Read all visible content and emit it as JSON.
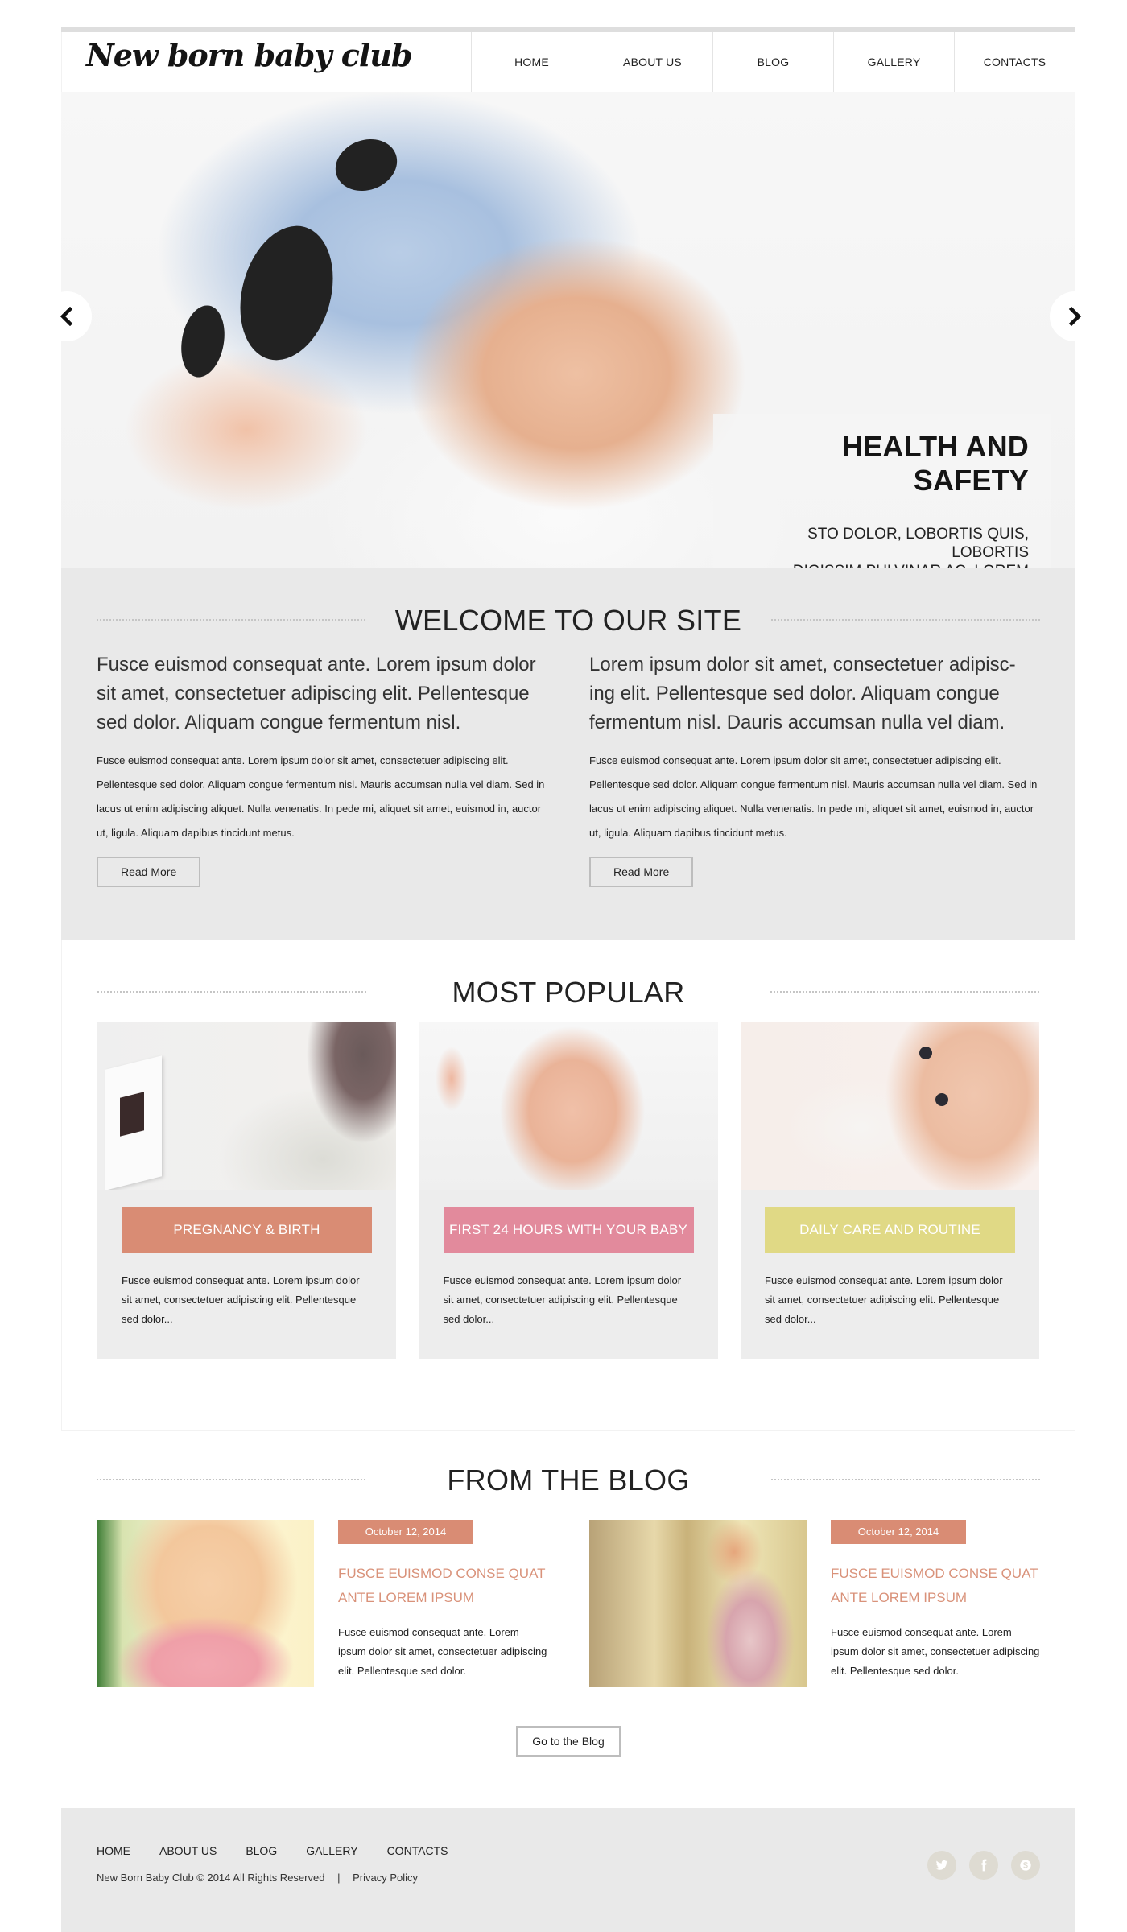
{
  "header": {
    "logo": "New born baby club",
    "nav": [
      "HOME",
      "ABOUT US",
      "BLOG",
      "GALLERY",
      "CONTACTS"
    ]
  },
  "slider": {
    "title": "HEALTH AND SAFETY",
    "subtitle_line1": "STO DOLOR, LOBORTIS QUIS, LOBORTIS",
    "subtitle_line2": "DIGISSIM PULVINAR AC, LOREM",
    "prev_icon": "chevron-left-icon",
    "next_icon": "chevron-right-icon"
  },
  "welcome": {
    "title": "WELCOME TO OUR SITE",
    "columns": [
      {
        "lead": "Fusce euismod consequat ante. Lorem ipsum dolor sit amet, consectetuer adipiscing elit. Pellentesque sed dolor. Aliquam congue fermentum nisl.",
        "body": "Fusce euismod consequat ante. Lorem ipsum dolor sit amet, consectetuer adipiscing elit. Pellentesque sed dolor. Aliquam congue fermentum nisl. Mauris accumsan nulla vel diam. Sed in lacus ut enim adipiscing aliquet. Nulla venenatis. In pede mi, aliquet sit amet, euismod in, auctor ut, ligula. Aliquam dapibus tincidunt metus.",
        "button": "Read More"
      },
      {
        "lead": "Lorem ipsum dolor sit amet, consectetuer adipisc-ing elit. Pellentesque sed dolor. Aliquam congue fermentum nisl. Dauris accumsan nulla vel diam.",
        "body": "Fusce euismod consequat ante. Lorem ipsum dolor sit amet, consectetuer adipiscing elit. Pellentesque sed dolor. Aliquam congue fermentum nisl. Mauris accumsan nulla vel diam. Sed in lacus ut enim adipiscing aliquet. Nulla venenatis. In pede mi, aliquet sit amet, euismod in, auctor ut, ligula. Aliquam dapibus tincidunt metus.",
        "button": "Read More"
      }
    ]
  },
  "popular": {
    "title": "MOST POPULAR",
    "cards": [
      {
        "label": "PREGNANCY & BIRTH",
        "color": "#d98c74",
        "text": "Fusce euismod consequat ante. Lorem ipsum dolor sit amet, consectetuer adipiscing elit. Pellentesque sed dolor..."
      },
      {
        "label": "FIRST 24 HOURS WITH YOUR BABY",
        "color": "#e28a9c",
        "text": "Fusce euismod consequat ante. Lorem ipsum dolor sit amet, consectetuer adipiscing elit. Pellentesque sed dolor..."
      },
      {
        "label": "DAILY CARE AND ROUTINE",
        "color": "#e0d985",
        "text": "Fusce euismod consequat ante. Lorem ipsum dolor sit amet, consectetuer adipiscing elit. Pellentesque sed dolor..."
      }
    ]
  },
  "blog": {
    "title": "FROM THE BLOG",
    "posts": [
      {
        "date": "October 12, 2014",
        "title": "FUSCE EUISMOD CONSE QUAT ANTE LOREM IPSUM",
        "text": "Fusce euismod consequat ante. Lorem ipsum dolor sit amet, consectetuer adipiscing elit. Pellentesque sed dolor."
      },
      {
        "date": "October 12, 2014",
        "title": "FUSCE EUISMOD CONSE QUAT ANTE LOREM IPSUM",
        "text": "Fusce euismod consequat ante. Lorem ipsum dolor sit amet, consectetuer adipiscing elit. Pellentesque sed dolor."
      }
    ],
    "button": "Go to the Blog"
  },
  "footer": {
    "nav": [
      "HOME",
      "ABOUT US",
      "BLOG",
      "GALLERY",
      "CONTACTS"
    ],
    "copyright": "New Born Baby Club © 2014 All Rights Reserved",
    "separator": "|",
    "privacy": "Privacy Policy",
    "socials": [
      "twitter-icon",
      "facebook-icon",
      "skype-icon"
    ]
  }
}
